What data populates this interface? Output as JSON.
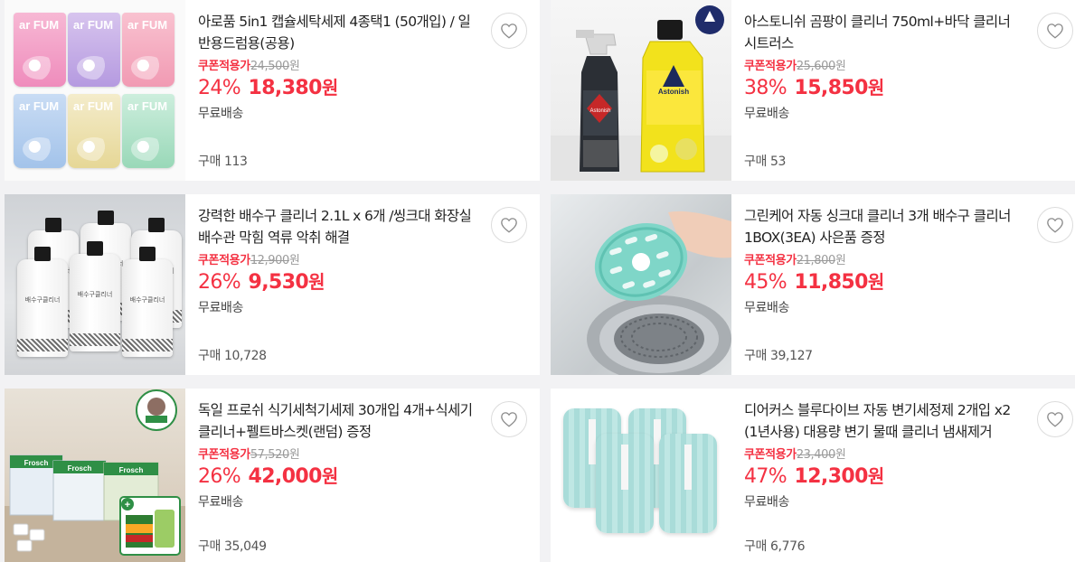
{
  "products": [
    {
      "title": "아로품 5in1 캡슐세탁세제 4종택1 (50개입) / 일반용드럼용(공용)",
      "coupon_label": "쿠폰적용가",
      "original_price": "24,500",
      "original_unit": "원",
      "discount_rate": "24%",
      "sale_price": "18,380",
      "sale_unit": "원",
      "shipping": "무료배송",
      "purchases": "구매 113",
      "image_brand": "ar FUM"
    },
    {
      "title": "아스토니쉬 곰팡이 클리너 750ml+바닥 클리너 시트러스",
      "coupon_label": "쿠폰적용가",
      "original_price": "25,600",
      "original_unit": "원",
      "discount_rate": "38%",
      "sale_price": "15,850",
      "sale_unit": "원",
      "shipping": "무료배송",
      "purchases": "구매 53",
      "image_brand": "Astonish"
    },
    {
      "title": "강력한 배수구 클리너 2.1L x 6개 /씽크대 화장실 배수관 막힘 역류 악취 해결",
      "coupon_label": "쿠폰적용가",
      "original_price": "12,900",
      "original_unit": "원",
      "discount_rate": "26%",
      "sale_price": "9,530",
      "sale_unit": "원",
      "shipping": "무료배송",
      "purchases": "구매 10,728",
      "image_label": "배수구클리너"
    },
    {
      "title": "그린케어 자동 싱크대 클리너 3개 배수구 클리너 1BOX(3EA) 사은품 증정",
      "coupon_label": "쿠폰적용가",
      "original_price": "21,800",
      "original_unit": "원",
      "discount_rate": "45%",
      "sale_price": "11,850",
      "sale_unit": "원",
      "shipping": "무료배송",
      "purchases": "구매 39,127"
    },
    {
      "title": "독일 프로쉬 식기세척기세제 30개입 4개+식세기클리너+펠트바스켓(랜덤) 증정",
      "coupon_label": "쿠폰적용가",
      "original_price": "57,520",
      "original_unit": "원",
      "discount_rate": "26%",
      "sale_price": "42,000",
      "sale_unit": "원",
      "shipping": "무료배송",
      "purchases": "구매 35,049",
      "image_brand": "Frosch"
    },
    {
      "title": "디어커스 블루다이브 자동 변기세정제 2개입 x2 (1년사용) 대용량 변기 물때 클리너 냄새제거",
      "coupon_label": "쿠폰적용가",
      "original_price": "23,400",
      "original_unit": "원",
      "discount_rate": "47%",
      "sale_price": "12,300",
      "sale_unit": "원",
      "shipping": "무료배송",
      "purchases": "구매 6,776"
    }
  ],
  "colors": {
    "accent": "#f43142",
    "muted": "#9a9a9a",
    "background": "#f2f2f4"
  },
  "icons": {
    "wishlist": "heart-outline-icon"
  }
}
